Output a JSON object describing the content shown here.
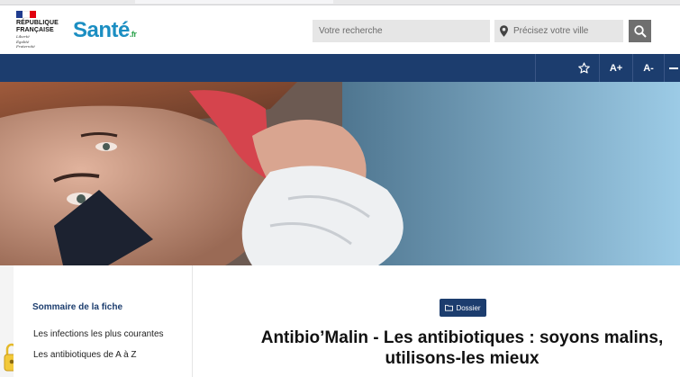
{
  "header": {
    "logo_rf": {
      "line1": "RÉPUBLIQUE",
      "line2": "FRANÇAISE",
      "motto1": "Liberté",
      "motto2": "Égalité",
      "motto3": "Fraternité"
    },
    "brand": {
      "name": "Santé",
      "suffix": ".fr",
      "color": "#1b8ec2",
      "suffix_color": "#2fa44f"
    },
    "search": {
      "placeholder": "Votre recherche"
    },
    "city": {
      "placeholder": "Précisez votre ville"
    },
    "search_button_icon": "magnifier-icon"
  },
  "navbar": {
    "color": "#1c3d6e",
    "favorite_icon": "star-icon",
    "font_increase": "A+",
    "font_decrease": "A-"
  },
  "sidebar": {
    "title": "Sommaire de la fiche",
    "items": [
      {
        "label": "Les infections les plus courantes"
      },
      {
        "label": "Les antibiotiques de A à Z"
      }
    ]
  },
  "article": {
    "badge": "Dossier",
    "title_line1": "Antibio’Malin - Les antibiotiques : soyons malins,",
    "title_line2": "utilisons-les mieux"
  }
}
